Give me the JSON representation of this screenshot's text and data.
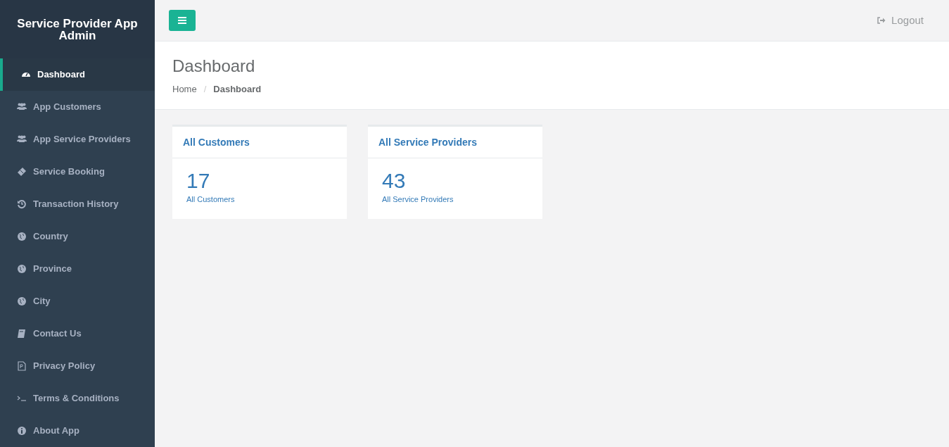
{
  "sidebar": {
    "title": "Service Provider App Admin",
    "items": [
      {
        "label": "Dashboard",
        "kind": "gauge",
        "selected": true
      },
      {
        "label": "App Customers",
        "kind": "users",
        "selected": false
      },
      {
        "label": "App Service Providers",
        "kind": "users",
        "selected": false
      },
      {
        "label": "Service Booking",
        "kind": "ticket",
        "selected": false
      },
      {
        "label": "Transaction History",
        "kind": "history",
        "selected": false
      },
      {
        "label": "Country",
        "kind": "globe",
        "selected": false
      },
      {
        "label": "Province",
        "kind": "globe",
        "selected": false
      },
      {
        "label": "City",
        "kind": "globe",
        "selected": false
      },
      {
        "label": "Contact Us",
        "kind": "book",
        "selected": false
      },
      {
        "label": "Privacy Policy",
        "kind": "file",
        "selected": false
      },
      {
        "label": "Terms & Conditions",
        "kind": "terminal",
        "selected": false
      },
      {
        "label": "About App",
        "kind": "info",
        "selected": false
      }
    ]
  },
  "topbar": {
    "logout": "Logout"
  },
  "page_header": {
    "title": "Dashboard",
    "breadcrumb": [
      "Home",
      "Dashboard"
    ],
    "breadcrumb_separator": "/"
  },
  "cards": [
    {
      "title": "All Customers",
      "count": "17",
      "caption": "All Customers"
    },
    {
      "title": "All Service Providers",
      "count": "43",
      "caption": "All Service Providers"
    }
  ]
}
